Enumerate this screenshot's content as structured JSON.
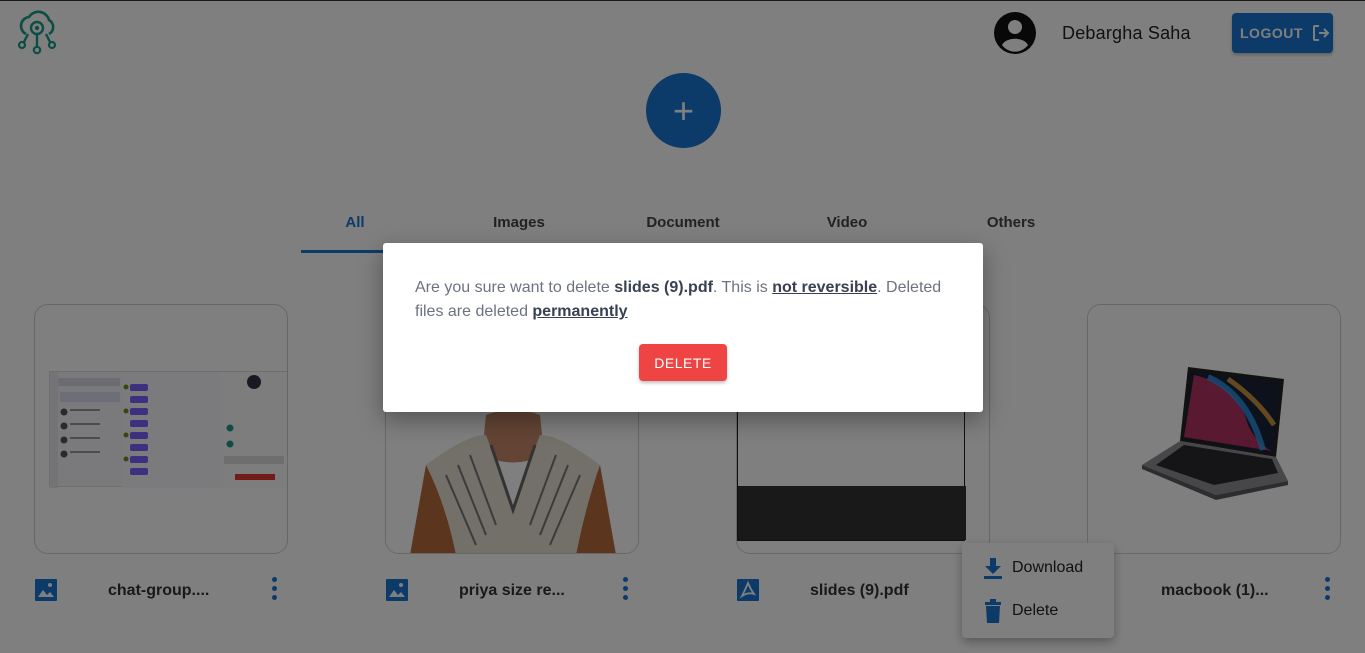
{
  "header": {
    "user_name": "Debargha Saha",
    "logout_label": "LOGOUT"
  },
  "upload": {
    "icon": "plus-icon",
    "label": "+"
  },
  "tabs": [
    {
      "label": "All",
      "active": true
    },
    {
      "label": "Images"
    },
    {
      "label": "Document"
    },
    {
      "label": "Video"
    },
    {
      "label": "Others"
    }
  ],
  "files": [
    {
      "name": "chat-group....",
      "type": "image"
    },
    {
      "name": "priya size re...",
      "type": "image"
    },
    {
      "name": "slides (9).pdf",
      "type": "pdf"
    },
    {
      "name": "macbook (1)...",
      "type": "image"
    }
  ],
  "context_menu": {
    "download_label": "Download",
    "delete_label": "Delete"
  },
  "dialog": {
    "text_1": "Are you sure want to delete ",
    "file_name": "slides (9).pdf",
    "text_2": ". This is ",
    "not_reversible": "not reversible",
    "text_3": ". Deleted files are deleted ",
    "permanently": "permanently",
    "delete_label": "DELETE"
  },
  "colors": {
    "primary": "#1976d2",
    "danger": "#ef4444",
    "overlay": "rgba(0,0,0,0.5)"
  }
}
